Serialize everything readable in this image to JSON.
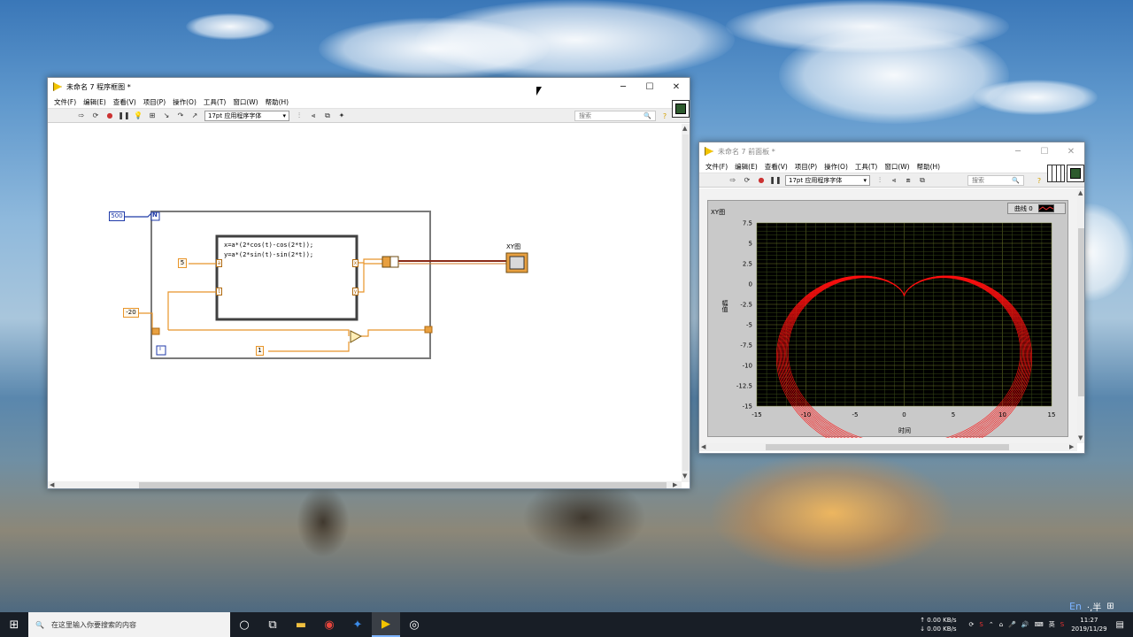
{
  "diagram_window": {
    "title": "未命名 7 程序框图 *",
    "menus": [
      "文件(F)",
      "编辑(E)",
      "查看(V)",
      "项目(P)",
      "操作(O)",
      "工具(T)",
      "窗口(W)",
      "帮助(H)"
    ],
    "font": "17pt 应用程序字体",
    "search_placeholder": "搜索"
  },
  "diagram": {
    "N": "N",
    "count": "500",
    "formula_line1": "x=a*(2*cos(t)-cos(2*t));",
    "formula_line2": "y=a*(2*sin(t)-sin(2*t));",
    "a_const": "5",
    "t_start": "-20",
    "i_label": "i",
    "increment": "1",
    "graph_label": "XY图",
    "port_a": "a",
    "port_t": "t",
    "port_x": "x",
    "port_y": "y"
  },
  "panel_window": {
    "title": "未命名 7 前面板 *",
    "menus": [
      "文件(F)",
      "编辑(E)",
      "查看(V)",
      "项目(P)",
      "操作(O)",
      "工具(T)",
      "窗口(W)",
      "帮助(H)"
    ],
    "font": "17pt 应用程序字体",
    "search_placeholder": "搜索",
    "graph_label": "XY图",
    "legend": "曲线 0",
    "xlabel": "时间",
    "ylabel": "幅值"
  },
  "chart_data": {
    "type": "scatter",
    "title": "XY图",
    "series": [
      {
        "name": "曲线 0",
        "color": "#ff1010",
        "equation": "x=a*(2*cos(t)-cos(2*t)), y=a*(2*sin(t)-sin(2*t))"
      }
    ],
    "xlabel": "时间",
    "ylabel": "幅值",
    "xlim": [
      -15,
      15
    ],
    "ylim": [
      -15,
      7.5
    ],
    "xticks": [
      "-15",
      "-10",
      "-5",
      "0",
      "5",
      "10",
      "15"
    ],
    "yticks": [
      "7.5",
      "5",
      "2.5",
      "0",
      "-2.5",
      "-5",
      "-7.5",
      "-10",
      "-12.5",
      "-15"
    ],
    "grid": true,
    "background": "#000000"
  },
  "taskbar": {
    "search_placeholder": "在这里输入你要搜索的内容",
    "net_up": "↑ 0.00 KB/s",
    "net_down": "↓ 0.00 KB/s",
    "ime": "En",
    "ime2": "英",
    "ime_mode": "·,半",
    "time": "11:27",
    "date": "2019/11/29"
  }
}
